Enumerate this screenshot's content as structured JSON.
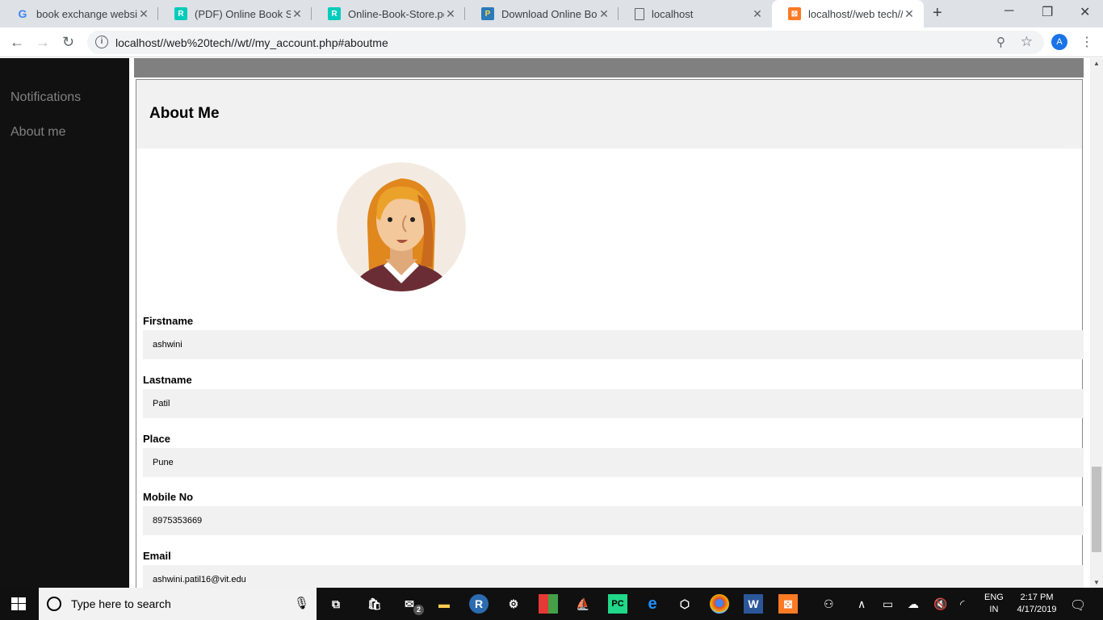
{
  "tabs": [
    {
      "title": "book exchange website",
      "icon": "google-icon",
      "color": "#4285f4"
    },
    {
      "title": "(PDF) Online Book Store",
      "icon": "researchgate-icon",
      "color": "#00ccbb"
    },
    {
      "title": "Online-Book-Store.pdf",
      "icon": "researchgate-icon",
      "color": "#00ccbb"
    },
    {
      "title": "Download Online Book",
      "icon": "project-icon",
      "color": "#2b7bb9"
    },
    {
      "title": "localhost",
      "icon": "page-icon",
      "color": "#ffffff"
    },
    {
      "title": "localhost//web tech//wt//my_account.php",
      "icon": "xampp-icon",
      "color": "#fb7a24"
    }
  ],
  "toolbar": {
    "url": "localhost//web%20tech//wt//my_account.php#aboutme",
    "profile_initial": "A"
  },
  "sidebar": {
    "items": [
      "Notifications",
      "About me"
    ]
  },
  "card": {
    "title": "About Me"
  },
  "fields": [
    {
      "label": "Firstname",
      "value": "ashwini"
    },
    {
      "label": "Lastname",
      "value": "Patil"
    },
    {
      "label": "Place",
      "value": "Pune"
    },
    {
      "label": "Mobile No",
      "value": "8975353669"
    },
    {
      "label": "Email",
      "value": "ashwini.patil16@vit.edu"
    }
  ],
  "taskbar": {
    "search_placeholder": "Type here to search",
    "mail_badge": "2",
    "lang_line1": "ENG",
    "lang_line2": "IN",
    "time": "2:17 PM",
    "date": "4/17/2019"
  }
}
